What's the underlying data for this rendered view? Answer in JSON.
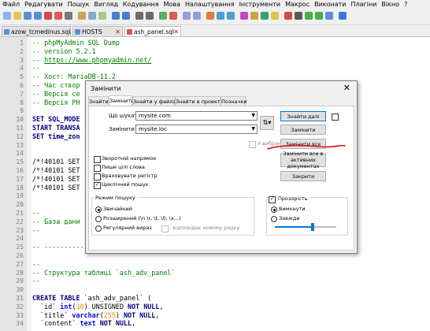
{
  "menu": [
    "Файл",
    "Редагувати",
    "Пошук",
    "Вигляд",
    "Кодування",
    "Мова",
    "Налаштування",
    "Інструменти",
    "Макрос",
    "Виконати",
    "Плагіни",
    "Вікно",
    "?"
  ],
  "tabs": [
    "azow_tcmedinus.sql",
    "HOSTS",
    "ash_panel.sql"
  ],
  "line_numbers": [
    "1",
    "2",
    "3",
    "4",
    "5",
    "6",
    "7",
    "8",
    "9",
    "10",
    "11",
    "12",
    "13",
    "14",
    "15",
    "16",
    "17",
    "18",
    "19",
    "20",
    "21",
    "22",
    "23",
    "24",
    "25",
    "26",
    "27",
    "28",
    "29",
    "30",
    "31",
    "32",
    "33",
    "34"
  ],
  "code": {
    "l1": "-- phpMyAdmin SQL Dump",
    "l2": "-- version 5.2.1",
    "l3_prefix": "-- ",
    "l3_link": "https://www.phpmyadmin.net/",
    "l4": "--",
    "l5": "-- Хост: MariaDB-11.2",
    "l6": "-- Час створ",
    "l7": "-- Версія се",
    "l8": "-- Версія PH",
    "l10a": "SET SQL_MODE",
    "l11a": "START TRANSA",
    "l12a": "SET time_zon",
    "l15": "/*!40101 SET",
    "l16": "/*!40101 SET",
    "l17": "/*!40101 SET",
    "l18": "/*!40101 SET",
    "l21": "--",
    "l22": "-- База дани",
    "l23": "--",
    "l25": "-- -----------",
    "l27": "--",
    "l28": "-- Структура таблиці `ash_adv_panel`",
    "l29": "--",
    "l31a": "CREATE TABLE",
    "l31b": " `ash_adv_panel` (",
    "l32a": "  `id` ",
    "l32b": "int",
    "l32c": "(",
    "l32d": "10",
    "l32e": ") UNSIGNED ",
    "l32f": "NOT NULL",
    "l32g": ",",
    "l33a": "  `title` ",
    "l33b": "varchar",
    "l33c": "(",
    "l33d": "255",
    "l33e": ") ",
    "l33f": "NOT NULL",
    "l33g": ",",
    "l34a": "  `content` ",
    "l34b": "text ",
    "l34c": "NOT NULL",
    "l34d": ","
  },
  "dialog": {
    "title": "Замінити",
    "close_glyph": "✕",
    "tabs": [
      "Знайти",
      "Замінити",
      "Знайти у файлах",
      "Знайти в проектах",
      "Позначки"
    ],
    "find_label": "Що шукати:",
    "find_value": "mysite.com",
    "replace_label": "Замінити на:",
    "replace_value": "mysite.loc",
    "in_selection": "У вибраному",
    "buttons": {
      "find_next": "Знайти далі",
      "replace": "Замінити",
      "replace_all": "Замінити все",
      "replace_all_open": "Замінити все в активних документах",
      "close": "Закрити"
    },
    "options": {
      "backward": "Зворотній напрямок",
      "whole_word": "Лише цілі слова",
      "match_case": "Враховувати регістр",
      "wrap": "Циклічний пошук"
    },
    "search_mode": {
      "title": "Режим пошуку",
      "normal": "Звичайний",
      "extended": "Розширений (\\n \\r, \\t, \\0, \\x...)",
      "regex": "Регулярний вираз",
      "dot_newline": ". відповідає новому рядку"
    },
    "transparency": {
      "title": "Прозорість",
      "on_lose_focus": "Вимкнути",
      "always": "Завжди",
      "level": 0.62
    }
  }
}
